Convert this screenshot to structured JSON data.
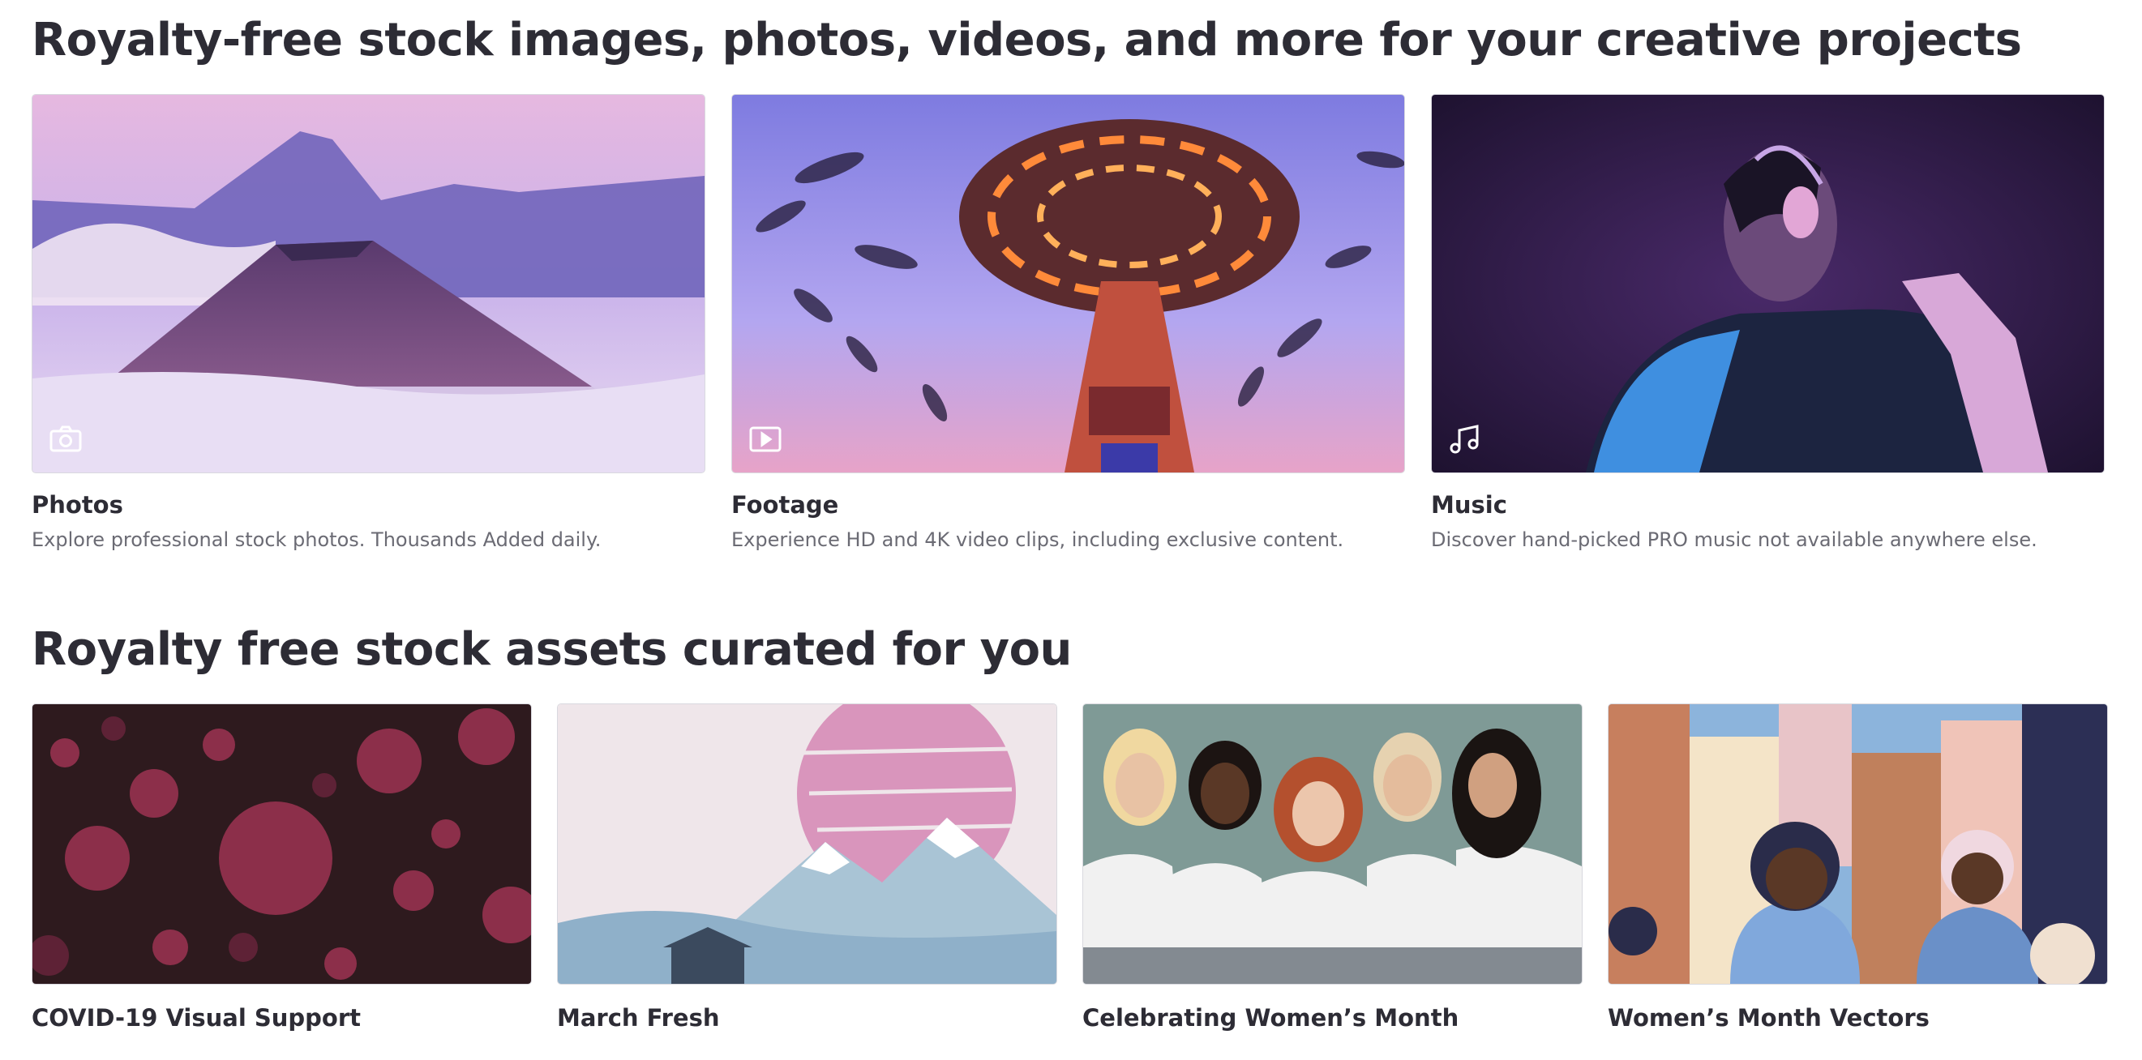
{
  "hero": {
    "title": "Royalty-free stock images, photos, videos, and more for your creative projects",
    "cards": [
      {
        "title": "Photos",
        "description": "Explore professional stock photos. Thousands Added daily.",
        "icon": "camera-icon"
      },
      {
        "title": "Footage",
        "description": "Experience HD and 4K video clips, including exclusive content.",
        "icon": "play-icon"
      },
      {
        "title": "Music",
        "description": "Discover hand-picked PRO music not available anywhere else.",
        "icon": "music-note-icon"
      }
    ]
  },
  "curated": {
    "title": "Royalty free stock assets curated for you",
    "cards": [
      {
        "title": "COVID-19 Visual Support"
      },
      {
        "title": "March Fresh"
      },
      {
        "title": "Celebrating Women’s Month"
      },
      {
        "title": "Women’s Month Vectors"
      }
    ]
  },
  "colors": {
    "heading": "#2d2c35",
    "description": "#6b6b74",
    "accent_purple": "#8a7fd9"
  }
}
